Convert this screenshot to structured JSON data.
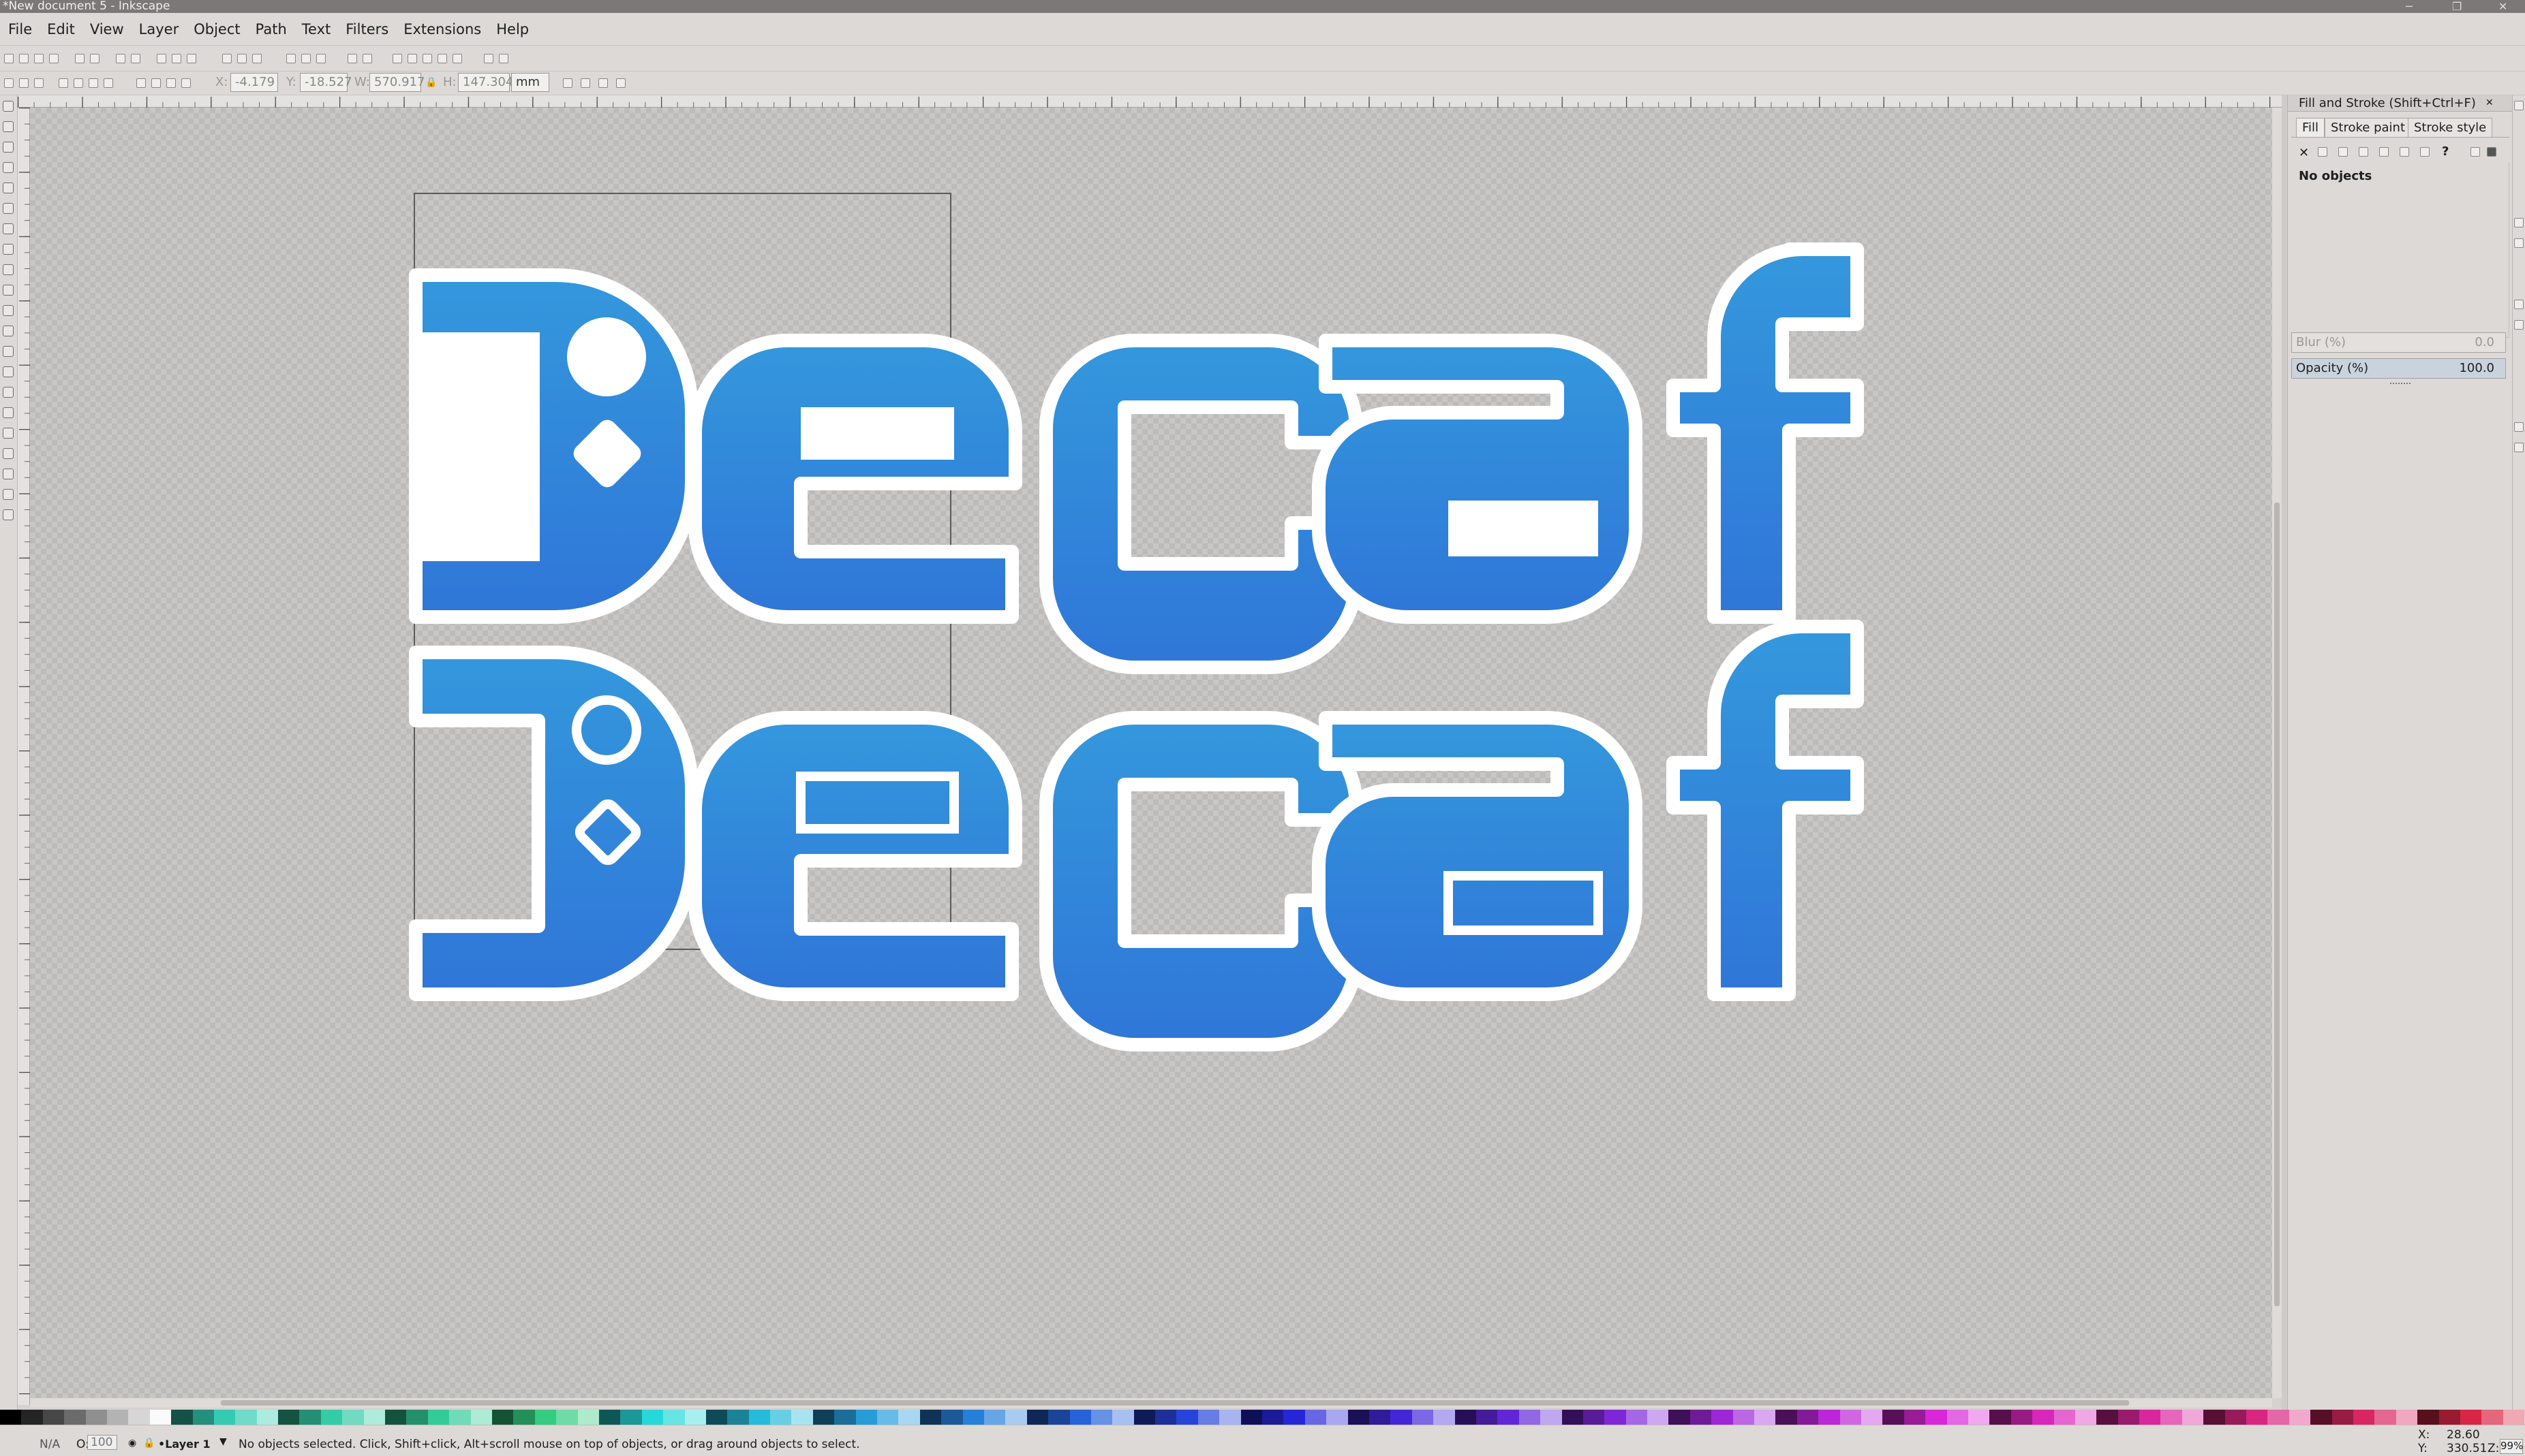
{
  "window": {
    "title": "*New document 5 - Inkscape",
    "minimize": "─",
    "maximize": "❐",
    "close": "✕"
  },
  "menu": [
    "File",
    "Edit",
    "View",
    "Layer",
    "Object",
    "Path",
    "Text",
    "Filters",
    "Extensions",
    "Help"
  ],
  "toolbar": {
    "x_label": "X:",
    "x_value": "-4.179",
    "y_label": "Y:",
    "y_value": "-18.527",
    "w_label": "W:",
    "w_value": "570.917",
    "h_label": "H:",
    "h_value": "147.304",
    "lock_label": "🔒",
    "unit": "mm"
  },
  "logo": {
    "line1": "Decaf",
    "line2": "Decaf",
    "color": "#2f85d9"
  },
  "panel": {
    "title": "Fill and Stroke (Shift+Ctrl+F)",
    "tabs": [
      "Fill",
      "Stroke paint",
      "Stroke style"
    ],
    "paint_types": [
      "no-paint-icon",
      "flat-color-icon",
      "linear-gradient-icon",
      "radial-gradient-icon",
      "mesh-gradient-icon",
      "pattern-icon",
      "swatch-icon",
      "unset-paint-icon"
    ],
    "no_paint_glyph": "✕",
    "unset_glyph": "?",
    "empty_message": "No objects",
    "blur_label": "Blur (%)",
    "blur_value": "0.0",
    "opacity_label": "Opacity (%)",
    "opacity_value": "100.0"
  },
  "status": {
    "fill_label": "N/A",
    "opacity_label": "O:",
    "opacity_value": "100",
    "layer_name": "•Layer 1",
    "message": "No objects selected. Click, Shift+click, Alt+scroll mouse on top of objects, or drag around objects to select.",
    "cursor_x_label": "X:",
    "cursor_x": "28.60",
    "cursor_y_label": "Y:",
    "cursor_y": "330.51",
    "zoom_label": "Z:",
    "zoom_value": "99%"
  }
}
